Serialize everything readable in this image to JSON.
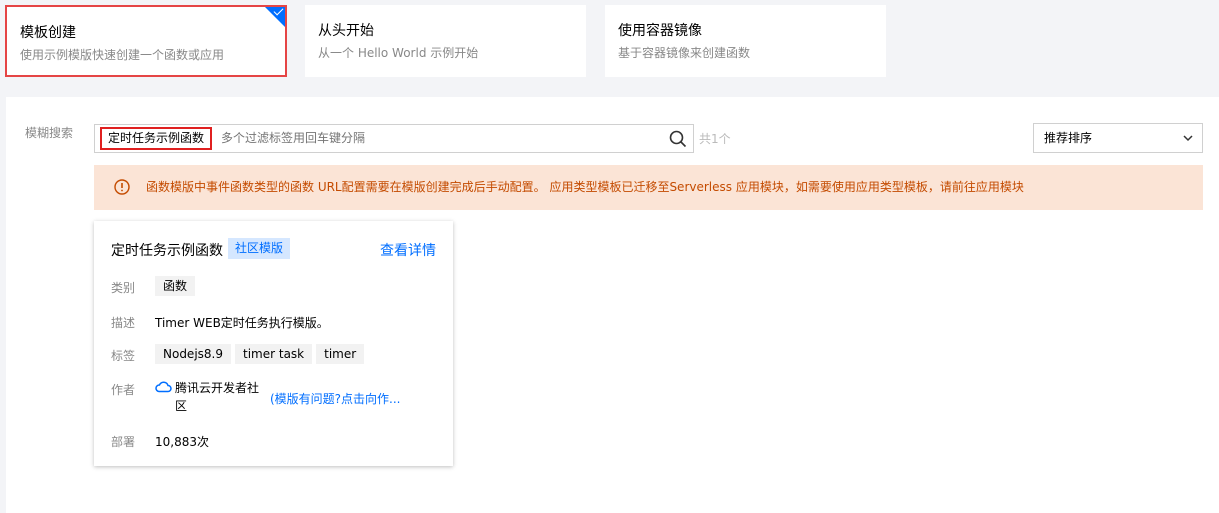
{
  "mode_cards": [
    {
      "title": "模板创建",
      "desc": "使用示例模版快速创建一个函数或应用",
      "selected": true
    },
    {
      "title": "从头开始",
      "desc": "从一个 Hello World 示例开始",
      "selected": false
    },
    {
      "title": "使用容器镜像",
      "desc": "基于容器镜像来创建函数",
      "selected": false
    }
  ],
  "search": {
    "label": "模糊搜索",
    "tag": "定时任务示例函数",
    "placeholder": "多个过滤标签用回车键分隔",
    "count": "共1个"
  },
  "sort": {
    "selected": "推荐排序"
  },
  "alert": {
    "text": "函数模版中事件函数类型的函数 URL配置需要在模版创建完成后手动配置。 应用类型模板已迁移至Serverless 应用模块，如需要使用应用类型模板，请前往应用模块"
  },
  "template": {
    "title": "定时任务示例函数",
    "badge": "社区模版",
    "detail_link": "查看详情",
    "labels": {
      "category": "类别",
      "desc": "描述",
      "tags": "标签",
      "author": "作者",
      "deploy": "部署"
    },
    "category": "函数",
    "description": "Timer WEB定时任务执行模版。",
    "tags": [
      "Nodejs8.9",
      "timer task",
      "timer"
    ],
    "author": "腾讯云开发者社区",
    "feedback": "(模版有问题?点击向作...",
    "deploys": "10,883次"
  },
  "colors": {
    "accent": "#006eff",
    "selected_border": "#e54545",
    "alert_bg": "#fbe4d6",
    "alert_text": "#c44b00"
  }
}
